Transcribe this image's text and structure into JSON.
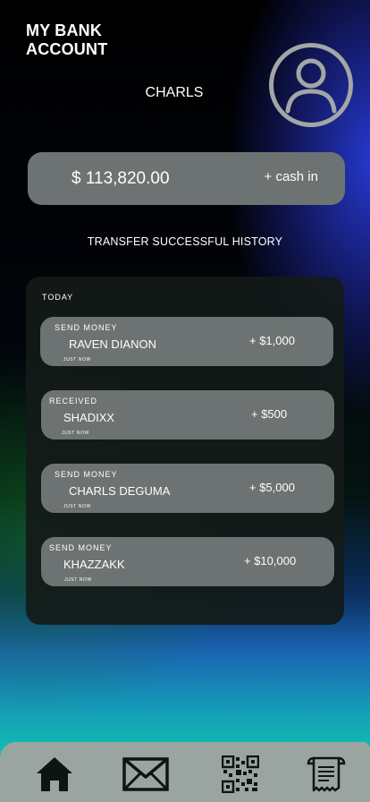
{
  "header": {
    "app_title": "MY BANK ACCOUNT",
    "user_name": "CHARLS",
    "avatar_icon": "user-circle-icon"
  },
  "balance": {
    "amount": "$ 113,820.00",
    "cash_in_label": "+ cash in"
  },
  "history": {
    "title": "TRANSFER SUCCESSFUL HISTORY",
    "section_label": "TODAY",
    "transactions": [
      {
        "type": "SEND MONEY",
        "name": "RAVEN DIANON",
        "time": "JUST NOW",
        "amount": "+ $1,000"
      },
      {
        "type": "RECEIVED",
        "name": "SHADIXX",
        "time": "JUST NOW",
        "amount": "+ $500"
      },
      {
        "type": "SEND MONEY",
        "name": "CHARLS DEGUMA",
        "time": "JUST NOW",
        "amount": "+ $5,000"
      },
      {
        "type": "SEND MONEY",
        "name": "KHAZZAKK",
        "time": "JUST NOW",
        "amount": "+ $10,000"
      }
    ]
  },
  "nav": {
    "items": [
      "home-icon",
      "mail-icon",
      "qr-code-icon",
      "receipt-icon"
    ]
  },
  "colors": {
    "card": "#6d7372",
    "panel": "#141a18",
    "nav_bar": "#9aa5a2",
    "icon_dark": "#0d1512"
  }
}
